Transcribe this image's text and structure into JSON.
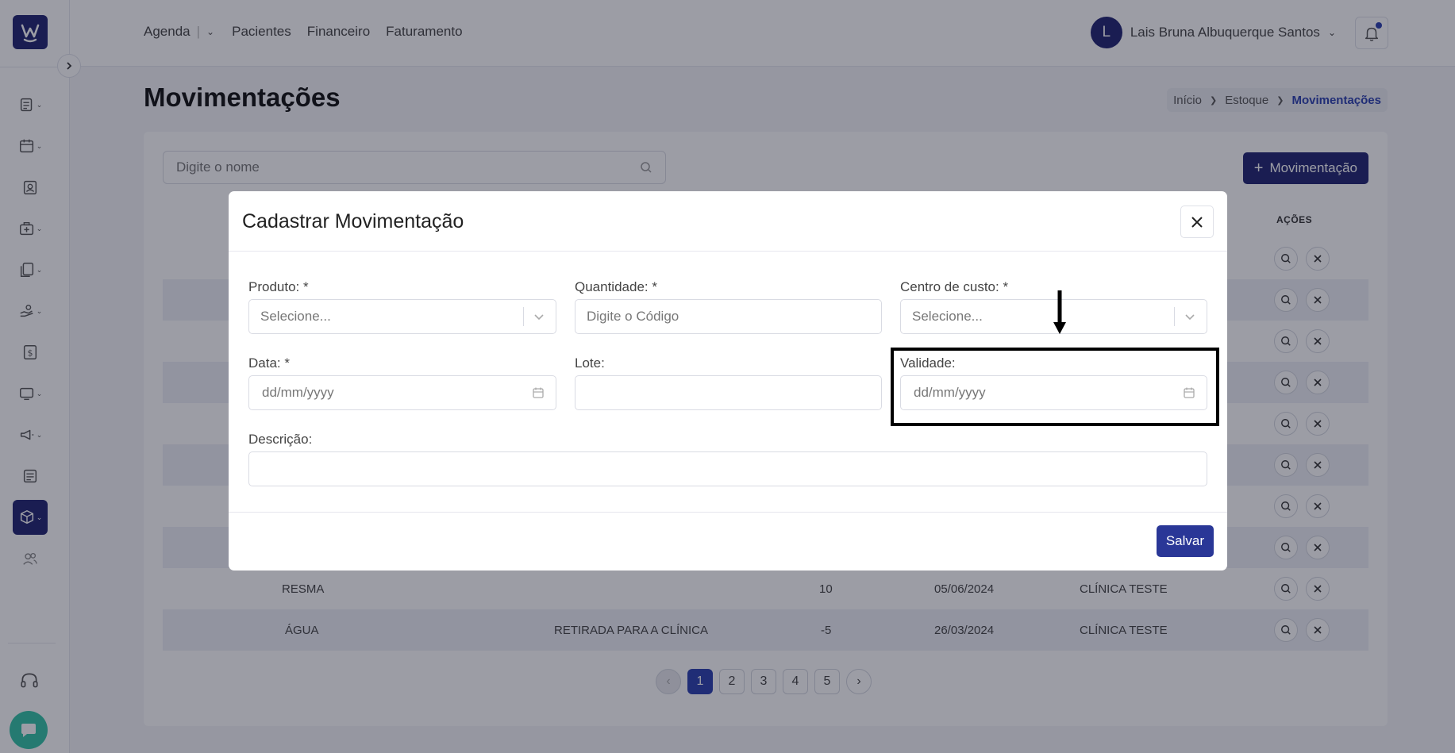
{
  "app": {
    "logo_letter": "W",
    "brand_color": "#1f2470",
    "accent_color": "#2a3faf"
  },
  "sidebar": {
    "items": [
      {
        "icon": "document-list-icon",
        "has_dropdown": true,
        "active": false
      },
      {
        "icon": "calendar-icon",
        "has_dropdown": true,
        "active": false
      },
      {
        "icon": "patient-card-icon",
        "has_dropdown": false,
        "active": false
      },
      {
        "icon": "medical-kit-icon",
        "has_dropdown": true,
        "active": false
      },
      {
        "icon": "documents-icon",
        "has_dropdown": true,
        "active": false
      },
      {
        "icon": "hand-coins-icon",
        "has_dropdown": true,
        "active": false
      },
      {
        "icon": "dollar-icon",
        "has_dropdown": false,
        "active": false
      },
      {
        "icon": "monitor-icon",
        "has_dropdown": true,
        "active": false
      },
      {
        "icon": "megaphone-icon",
        "has_dropdown": true,
        "active": false
      },
      {
        "icon": "newspaper-icon",
        "has_dropdown": false,
        "active": false
      },
      {
        "icon": "box-icon",
        "has_dropdown": true,
        "active": true
      },
      {
        "icon": "users-icon",
        "has_dropdown": false,
        "active": false
      }
    ]
  },
  "header": {
    "nav": {
      "agenda": "Agenda",
      "separator": "|",
      "pacientes": "Pacientes",
      "financeiro": "Financeiro",
      "faturamento": "Faturamento"
    },
    "user": {
      "initial": "L",
      "name": "Lais Bruna Albuquerque Santos"
    }
  },
  "page": {
    "title": "Movimentações",
    "breadcrumb": [
      "Início",
      "Estoque",
      "Movimentações"
    ],
    "search_placeholder": "Digite o nome",
    "add_button": "Movimentação",
    "actions_header": "AÇÕES",
    "visible_rows": [
      {
        "produto": "RESMA",
        "descricao": "",
        "quantidade": "10",
        "data": "05/06/2024",
        "centro": "CLÍNICA TESTE"
      },
      {
        "produto": "ÁGUA",
        "descricao": "RETIRADA PARA A CLÍNICA",
        "quantidade": "-5",
        "data": "26/03/2024",
        "centro": "CLÍNICA TESTE"
      }
    ],
    "pagination": {
      "pages": [
        "1",
        "2",
        "3",
        "4",
        "5"
      ],
      "current": "1"
    }
  },
  "modal": {
    "title": "Cadastrar Movimentação",
    "fields": {
      "produto": {
        "label": "Produto: *",
        "placeholder": "Selecione..."
      },
      "quantidade": {
        "label": "Quantidade: *",
        "placeholder": "Digite o Código"
      },
      "centro_custo": {
        "label": "Centro de custo: *",
        "placeholder": "Selecione..."
      },
      "data": {
        "label": "Data: *",
        "placeholder": "dd/mm/yyyy"
      },
      "lote": {
        "label": "Lote:",
        "value": ""
      },
      "validade": {
        "label": "Validade:",
        "placeholder": "dd/mm/yyyy"
      },
      "descricao": {
        "label": "Descrição:",
        "value": ""
      }
    },
    "save_label": "Salvar"
  }
}
